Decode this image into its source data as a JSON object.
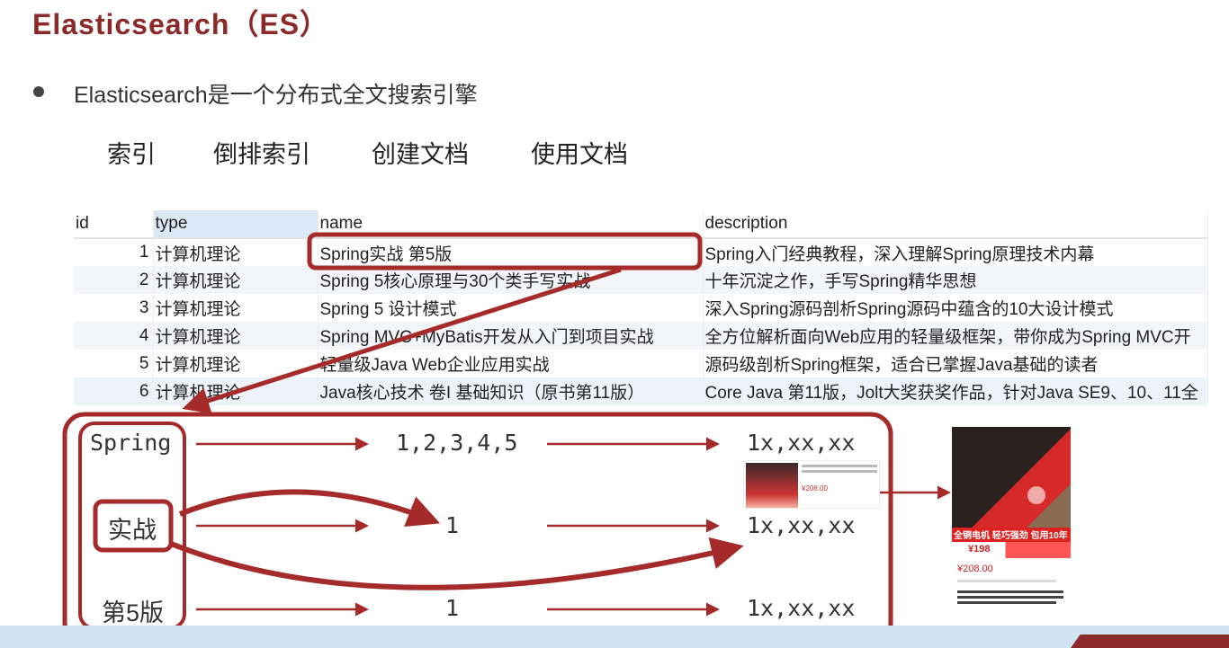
{
  "slide": {
    "title": "Elasticsearch（ES）",
    "bullet": "Elasticsearch是一个分布式全文搜索引擎",
    "keywords": [
      "索引",
      "倒排索引",
      "创建文档",
      "使用文档"
    ]
  },
  "table": {
    "headers": [
      "id",
      "type",
      "name",
      "description"
    ],
    "rows": [
      {
        "id": "1",
        "type": "计算机理论",
        "name": "Spring实战 第5版",
        "description": "Spring入门经典教程，深入理解Spring原理技术内幕"
      },
      {
        "id": "2",
        "type": "计算机理论",
        "name": "Spring 5核心原理与30个类手写实战",
        "description": "十年沉淀之作，手写Spring精华思想"
      },
      {
        "id": "3",
        "type": "计算机理论",
        "name": "Spring 5 设计模式",
        "description": "深入Spring源码剖析Spring源码中蕴含的10大设计模式"
      },
      {
        "id": "4",
        "type": "计算机理论",
        "name": "Spring MVC+MyBatis开发从入门到项目实战",
        "description": "全方位解析面向Web应用的轻量级框架，带你成为Spring MVC开"
      },
      {
        "id": "5",
        "type": "计算机理论",
        "name": "轻量级Java Web企业应用实战",
        "description": "源码级剖析Spring框架，适合已掌握Java基础的读者"
      },
      {
        "id": "6",
        "type": "计算机理论",
        "name": "Java核心技术 卷I 基础知识（原书第11版）",
        "description": "Core Java 第11版，Jolt大奖获奖作品，针对Java SE9、10、11全"
      }
    ]
  },
  "diagram": {
    "terms": [
      "Spring",
      "实战",
      "第5版"
    ],
    "ids": [
      "1,2,3,4,5",
      "1",
      "1"
    ],
    "docs": [
      "1x,xx,xx",
      "1x,xx,xx",
      "1x,xx,xx"
    ]
  },
  "product": {
    "banner": "全铜电机 轻巧强劲 包用10年",
    "promo_price": "¥198",
    "price": "¥208.00",
    "small_price": "¥208.00"
  },
  "colors": {
    "accent": "#a52a2a",
    "title": "#8b2a2a"
  }
}
